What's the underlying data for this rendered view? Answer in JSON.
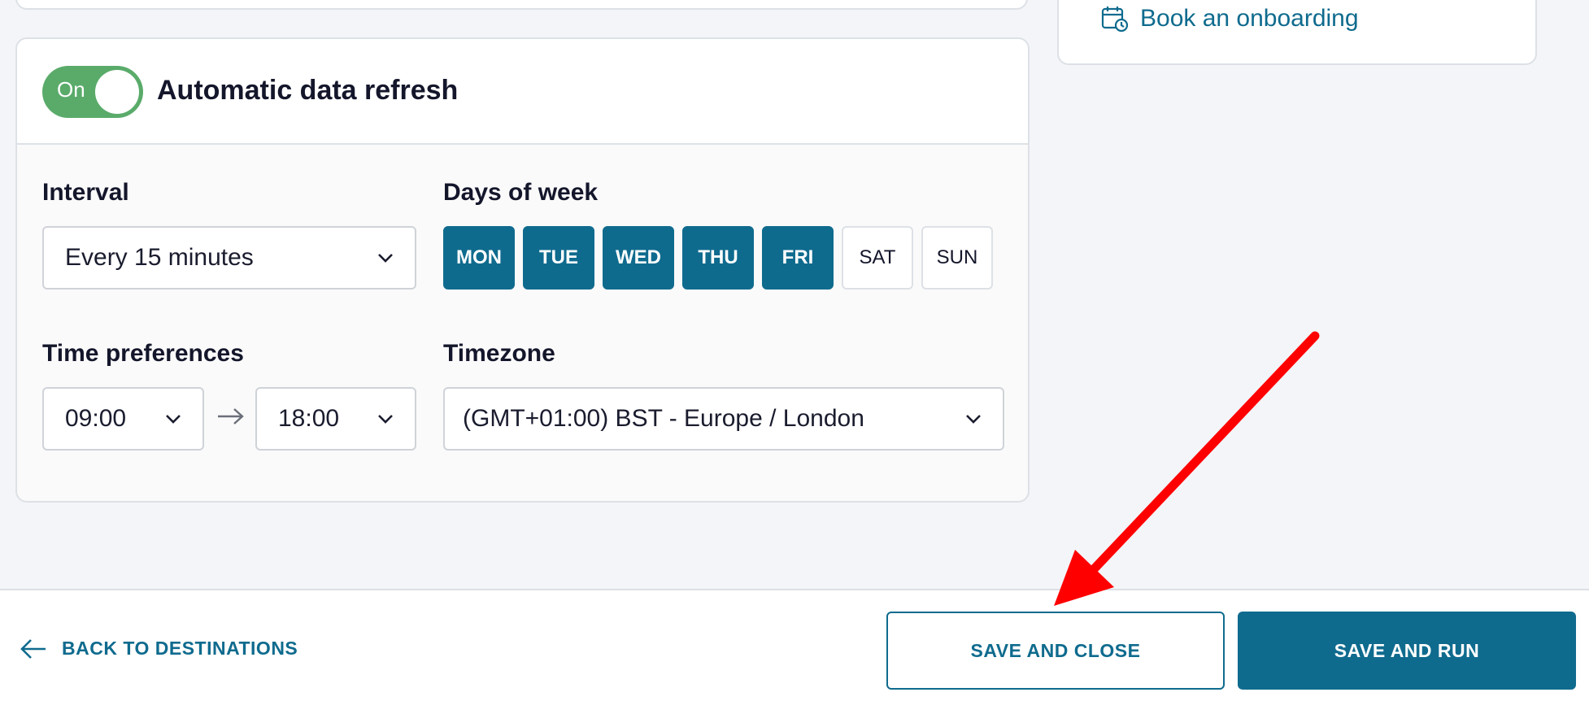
{
  "side_card": {
    "onboarding_label": "Book an onboarding",
    "onboarding_icon": "calendar-clock-icon"
  },
  "refresh": {
    "toggle_label": "On",
    "toggle_state": true,
    "title": "Automatic data refresh",
    "interval": {
      "label": "Interval",
      "value": "Every 15 minutes"
    },
    "days": {
      "label": "Days of week",
      "items": [
        {
          "label": "MON",
          "selected": true
        },
        {
          "label": "TUE",
          "selected": true
        },
        {
          "label": "WED",
          "selected": true
        },
        {
          "label": "THU",
          "selected": true
        },
        {
          "label": "FRI",
          "selected": true
        },
        {
          "label": "SAT",
          "selected": false
        },
        {
          "label": "SUN",
          "selected": false
        }
      ]
    },
    "time": {
      "label": "Time preferences",
      "start": "09:00",
      "end": "18:00"
    },
    "timezone": {
      "label": "Timezone",
      "value": "(GMT+01:00) BST - Europe / London"
    }
  },
  "footer": {
    "back_label": "BACK TO DESTINATIONS",
    "save_close_label": "SAVE AND CLOSE",
    "save_run_label": "SAVE AND RUN"
  },
  "colors": {
    "primary": "#0f6b8e",
    "toggle_on": "#5aab6a",
    "annotation": "#ff0000"
  }
}
